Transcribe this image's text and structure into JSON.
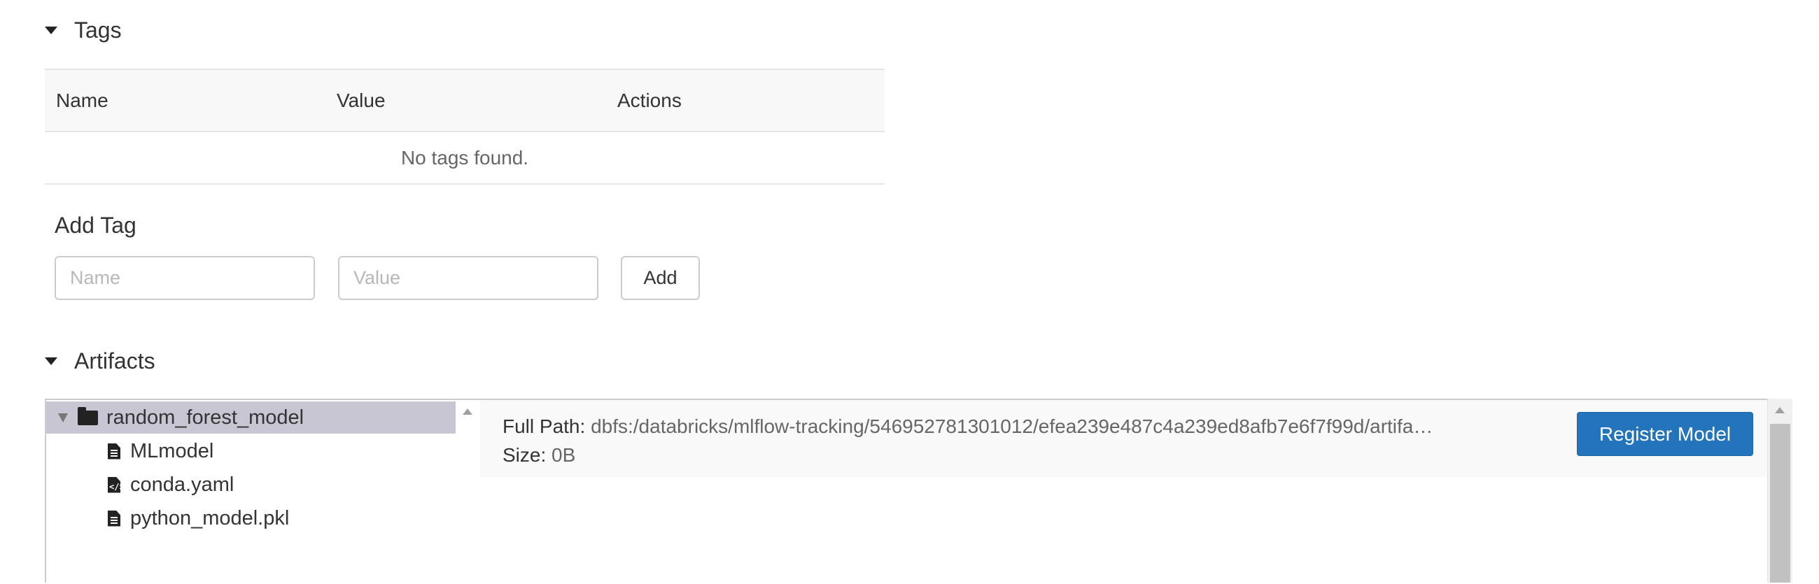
{
  "tags_section": {
    "title": "Tags",
    "columns": [
      "Name",
      "Value",
      "Actions"
    ],
    "empty_text": "No tags found."
  },
  "add_tag": {
    "title": "Add Tag",
    "name_placeholder": "Name",
    "value_placeholder": "Value",
    "add_label": "Add"
  },
  "artifacts_section": {
    "title": "Artifacts",
    "tree": {
      "root": "random_forest_model",
      "files": [
        {
          "name": "MLmodel",
          "icon": "file-text-icon"
        },
        {
          "name": "conda.yaml",
          "icon": "file-code-icon"
        },
        {
          "name": "python_model.pkl",
          "icon": "file-text-icon"
        }
      ]
    },
    "detail": {
      "full_path_label": "Full Path:",
      "full_path_value": "dbfs:/databricks/mlflow-tracking/546952781301012/efea239e487c4a239ed8afb7e6f7f99d/artifa…",
      "size_label": "Size:",
      "size_value": "0B",
      "register_label": "Register Model"
    }
  },
  "colors": {
    "primary_button": "#2374bb",
    "selected_row": "#c8c6d3"
  }
}
